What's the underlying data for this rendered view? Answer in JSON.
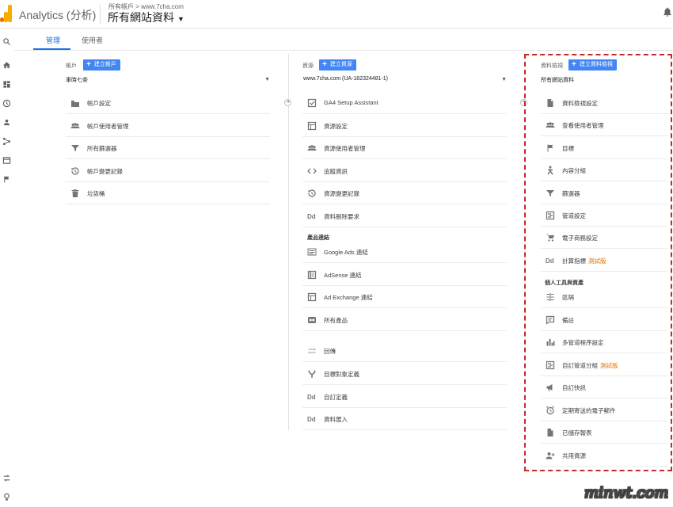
{
  "header": {
    "app_title": "Analytics (分析)",
    "breadcrumb": "所有帳戶 > www.7cha.com",
    "property_name": "所有網站資料"
  },
  "tabs": [
    {
      "label": "管理"
    },
    {
      "label": "使用者"
    }
  ],
  "account": {
    "label": "帳戶",
    "add_label": "建立帳戶",
    "selected": "車時七茶",
    "items": [
      {
        "label": "帳戶設定",
        "icon": "building-icon"
      },
      {
        "label": "帳戶使用者管理",
        "icon": "people-icon"
      },
      {
        "label": "所有篩選器",
        "icon": "filter-icon"
      },
      {
        "label": "帳戶變更記錄",
        "icon": "history-icon"
      },
      {
        "label": "垃圾桶",
        "icon": "trash-icon"
      }
    ]
  },
  "property": {
    "label": "資源",
    "add_label": "建立資源",
    "selected": "www.7cha.com (UA-182324481-1)",
    "items": [
      {
        "label": "GA4 Setup Assistant",
        "icon": "checkbox-icon"
      },
      {
        "label": "資源設定",
        "icon": "window-icon"
      },
      {
        "label": "資源使用者管理",
        "icon": "people-icon"
      },
      {
        "label": "追蹤資訊",
        "icon": "code-icon"
      },
      {
        "label": "資源變更記錄",
        "icon": "history-icon"
      },
      {
        "label": "資料刪除要求",
        "icon": "dd-icon"
      }
    ],
    "section_label": "產品連結",
    "product_links": [
      {
        "label": "Google Ads 連結",
        "icon": "ads-icon"
      },
      {
        "label": "AdSense 連結",
        "icon": "book-icon"
      },
      {
        "label": "Ad Exchange 連結",
        "icon": "window-icon"
      },
      {
        "label": "所有產品",
        "icon": "circles-icon"
      }
    ],
    "other_items": [
      {
        "label": "回傳",
        "icon": "swap-icon"
      },
      {
        "label": "目標對象定義",
        "icon": "fork-icon"
      },
      {
        "label": "自訂定義",
        "icon": "dd-icon"
      },
      {
        "label": "資料匯入",
        "icon": "dd-icon"
      }
    ]
  },
  "view": {
    "label": "資料檢視",
    "add_label": "建立資料檢視",
    "selected": "所有網站資料",
    "items": [
      {
        "label": "資料檢視設定",
        "icon": "document-icon",
        "badge": ""
      },
      {
        "label": "查看使用者管理",
        "icon": "people-icon",
        "badge": ""
      },
      {
        "label": "目標",
        "icon": "flag-icon",
        "badge": ""
      },
      {
        "label": "內容分組",
        "icon": "person-walk-icon",
        "badge": ""
      },
      {
        "label": "篩選器",
        "icon": "filter-icon",
        "badge": ""
      },
      {
        "label": "管道設定",
        "icon": "channel-icon",
        "badge": ""
      },
      {
        "label": "電子商務設定",
        "icon": "cart-icon",
        "badge": ""
      },
      {
        "label": "計算指標",
        "icon": "dd-icon",
        "badge": "測試版"
      }
    ],
    "section_label": "個人工具與資產",
    "personal_items": [
      {
        "label": "區隔",
        "icon": "segments-icon",
        "badge": ""
      },
      {
        "label": "備註",
        "icon": "comment-icon",
        "badge": ""
      },
      {
        "label": "多管道程序設定",
        "icon": "bar-chart-icon",
        "badge": ""
      },
      {
        "label": "自訂管道分組",
        "icon": "channel-icon",
        "badge": "測試版"
      },
      {
        "label": "自訂快訊",
        "icon": "megaphone-icon",
        "badge": ""
      },
      {
        "label": "定期寄送的電子郵件",
        "icon": "alarm-icon",
        "badge": ""
      },
      {
        "label": "已儲存報表",
        "icon": "document-icon",
        "badge": ""
      },
      {
        "label": "共用資源",
        "icon": "person-add-icon",
        "badge": ""
      }
    ]
  },
  "watermark": "minwt.com"
}
